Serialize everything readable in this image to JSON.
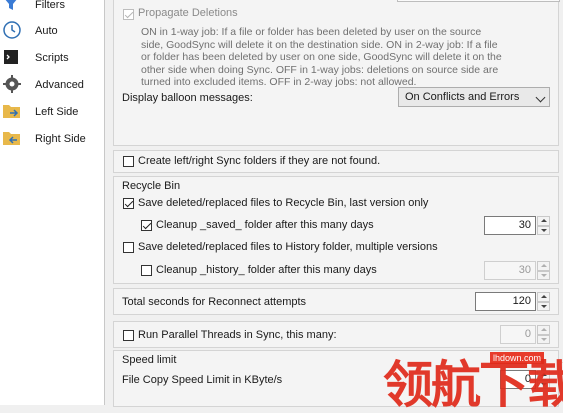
{
  "sidebar": {
    "items": [
      {
        "label": "Filters",
        "icon": "filter-icon"
      },
      {
        "label": "Auto",
        "icon": "clock-icon"
      },
      {
        "label": "Scripts",
        "icon": "terminal-icon"
      },
      {
        "label": "Advanced",
        "icon": "gear-icon"
      },
      {
        "label": "Left Side",
        "icon": "folder-arrow-right-icon"
      },
      {
        "label": "Right Side",
        "icon": "folder-arrow-left-icon"
      }
    ]
  },
  "propagate": {
    "label": "Propagate Deletions",
    "checked": true,
    "description": [
      "ON in 1-way job: If a file or folder has been deleted by user on the source",
      "side, GoodSync will delete it on the destination side.  ON in 2-way job: If a file",
      "or folder has been deleted by user on one side, GoodSync will delete it on the",
      "other side when doing Sync.  OFF in 1-way jobs: deletions on source side are",
      "turned into excluded items.  OFF in 2-way jobs: not allowed."
    ],
    "balloon_label": "Display balloon messages:",
    "balloon_value": "On Conflicts and Errors"
  },
  "create_folders": {
    "label": "Create left/right Sync folders if they are not found.",
    "checked": false
  },
  "recycle": {
    "title": "Recycle Bin",
    "save_recycle": {
      "label": "Save deleted/replaced files to Recycle Bin, last version only",
      "checked": true
    },
    "cleanup_saved": {
      "label": "Cleanup _saved_ folder after this many days",
      "checked": true,
      "value": "30"
    },
    "save_history": {
      "label": "Save deleted/replaced files to History folder, multiple versions",
      "checked": false
    },
    "cleanup_history": {
      "label": "Cleanup _history_ folder after this many days",
      "checked": false,
      "value": "30"
    }
  },
  "reconnect": {
    "label": "Total seconds for Reconnect attempts",
    "value": "120"
  },
  "parallel": {
    "label": "Run Parallel Threads in Sync, this many:",
    "checked": false,
    "value": "0"
  },
  "speed": {
    "title": "Speed limit",
    "label": "File Copy Speed Limit in KByte/s",
    "value": "0"
  },
  "watermark": {
    "domain": "lhdown.com",
    "text": "领航下载"
  },
  "colors": {
    "accent": "#0078d7",
    "panel": "#f0f0f0",
    "watermark": "#e02a1a"
  }
}
